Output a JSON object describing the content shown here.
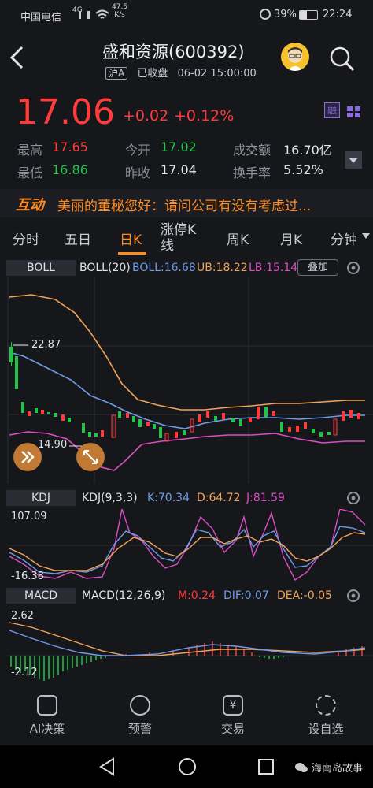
{
  "status_bar": {
    "carrier": "中国电信",
    "network": "4G",
    "speed_value": "47.5",
    "speed_unit": "K/s",
    "battery": "39%",
    "time": "22:24"
  },
  "header": {
    "title": "盛和资源(600392)",
    "market_badge": "沪A",
    "state": "已收盘",
    "datetime": "06-02 15:00:00"
  },
  "quote": {
    "price": "17.06",
    "change": "+0.02",
    "change_pct": "+0.12%",
    "margin_badge": "融",
    "high_label": "最高",
    "high": "17.65",
    "open_label": "今开",
    "open": "17.02",
    "volume_label": "成交额",
    "volume": "16.70亿",
    "low_label": "最低",
    "low": "16.86",
    "prev_close_label": "昨收",
    "prev_close": "17.04",
    "turnover_label": "换手率",
    "turnover": "5.52%"
  },
  "news": {
    "tag": "互动",
    "text": "美丽的董秘您好：请问公司有没有考虑过..."
  },
  "tabs": [
    "分时",
    "五日",
    "日K",
    "涨停K线",
    "周K",
    "月K",
    "分钟"
  ],
  "active_tab": "日K",
  "boll": {
    "name": "BOLL",
    "params": "BOLL(20)",
    "boll": "BOLL:16.68",
    "ub": "UB:18.22",
    "lb": "LB:15.14",
    "overlay_button": "叠加",
    "high_mark": "22.87",
    "low_mark": "14.90"
  },
  "kdj": {
    "name": "KDJ",
    "params": "KDJ(9,3,3)",
    "k": "K:70.34",
    "d": "D:64.72",
    "j": "J:81.59",
    "top": "107.09",
    "bottom": "-16.38"
  },
  "macd": {
    "name": "MACD",
    "params": "MACD(12,26,9)",
    "m": "M:0.24",
    "dif": "DIF:0.07",
    "dea": "DEA:-0.05",
    "top": "2.62",
    "bottom": "-2.12"
  },
  "bottom_nav": [
    {
      "label": "AI决策",
      "icon": "ai-decision-icon"
    },
    {
      "label": "预警",
      "icon": "alert-icon"
    },
    {
      "label": "交易",
      "icon": "trade-icon"
    },
    {
      "label": "设自选",
      "icon": "watchlist-icon"
    }
  ],
  "watermark": "海南岛故事",
  "colors": {
    "up": "#ff3b3b",
    "down": "#27c24c",
    "ub": "#f0a35a",
    "mid": "#6f9be8",
    "lb": "#d94fc3",
    "k": "#6f9be8",
    "d": "#f0a35a",
    "j": "#d94fc3"
  }
}
